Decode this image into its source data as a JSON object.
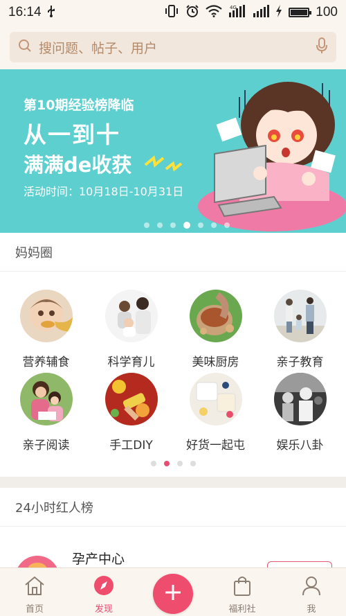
{
  "status_bar": {
    "time": "16:14",
    "network": "4G",
    "battery": "100"
  },
  "search": {
    "placeholder": "搜问题、帖子、用户"
  },
  "banner": {
    "subtitle": "第10期经验榜降临",
    "title": "从一到十",
    "title2": "满满de收获",
    "date": "活动时间：10月18日-10月31日",
    "dot_count": 7,
    "active_dot": 3
  },
  "mama_circle": {
    "title": "妈妈圈",
    "items": [
      {
        "label": "营养辅食",
        "icon": "baby-food-photo"
      },
      {
        "label": "科学育儿",
        "icon": "parents-baby-photo"
      },
      {
        "label": "美味厨房",
        "icon": "food-bowl-photo"
      },
      {
        "label": "亲子教育",
        "icon": "family-walk-photo"
      },
      {
        "label": "亲子阅读",
        "icon": "mother-child-reading-photo"
      },
      {
        "label": "手工DIY",
        "icon": "handcraft-photo"
      },
      {
        "label": "好货一起屯",
        "icon": "baby-goods-photo"
      },
      {
        "label": "娱乐八卦",
        "icon": "entertainment-photo"
      }
    ],
    "page_count": 4,
    "active_page": 1
  },
  "hot_list": {
    "title": "24小时红人榜",
    "items": [
      {
        "name": "孕产中心"
      }
    ]
  },
  "tabbar": {
    "items": [
      {
        "label": "首页",
        "icon": "home-icon"
      },
      {
        "label": "发现",
        "icon": "compass-icon"
      },
      {
        "label": "",
        "icon": "plus-icon"
      },
      {
        "label": "福利社",
        "icon": "shopping-bag-icon"
      },
      {
        "label": "我",
        "icon": "person-icon"
      }
    ],
    "active_index": 1
  },
  "colors": {
    "accent": "#ef4d6e",
    "banner_bg": "#5dcfcf",
    "header_bg": "#fbf5ef"
  }
}
